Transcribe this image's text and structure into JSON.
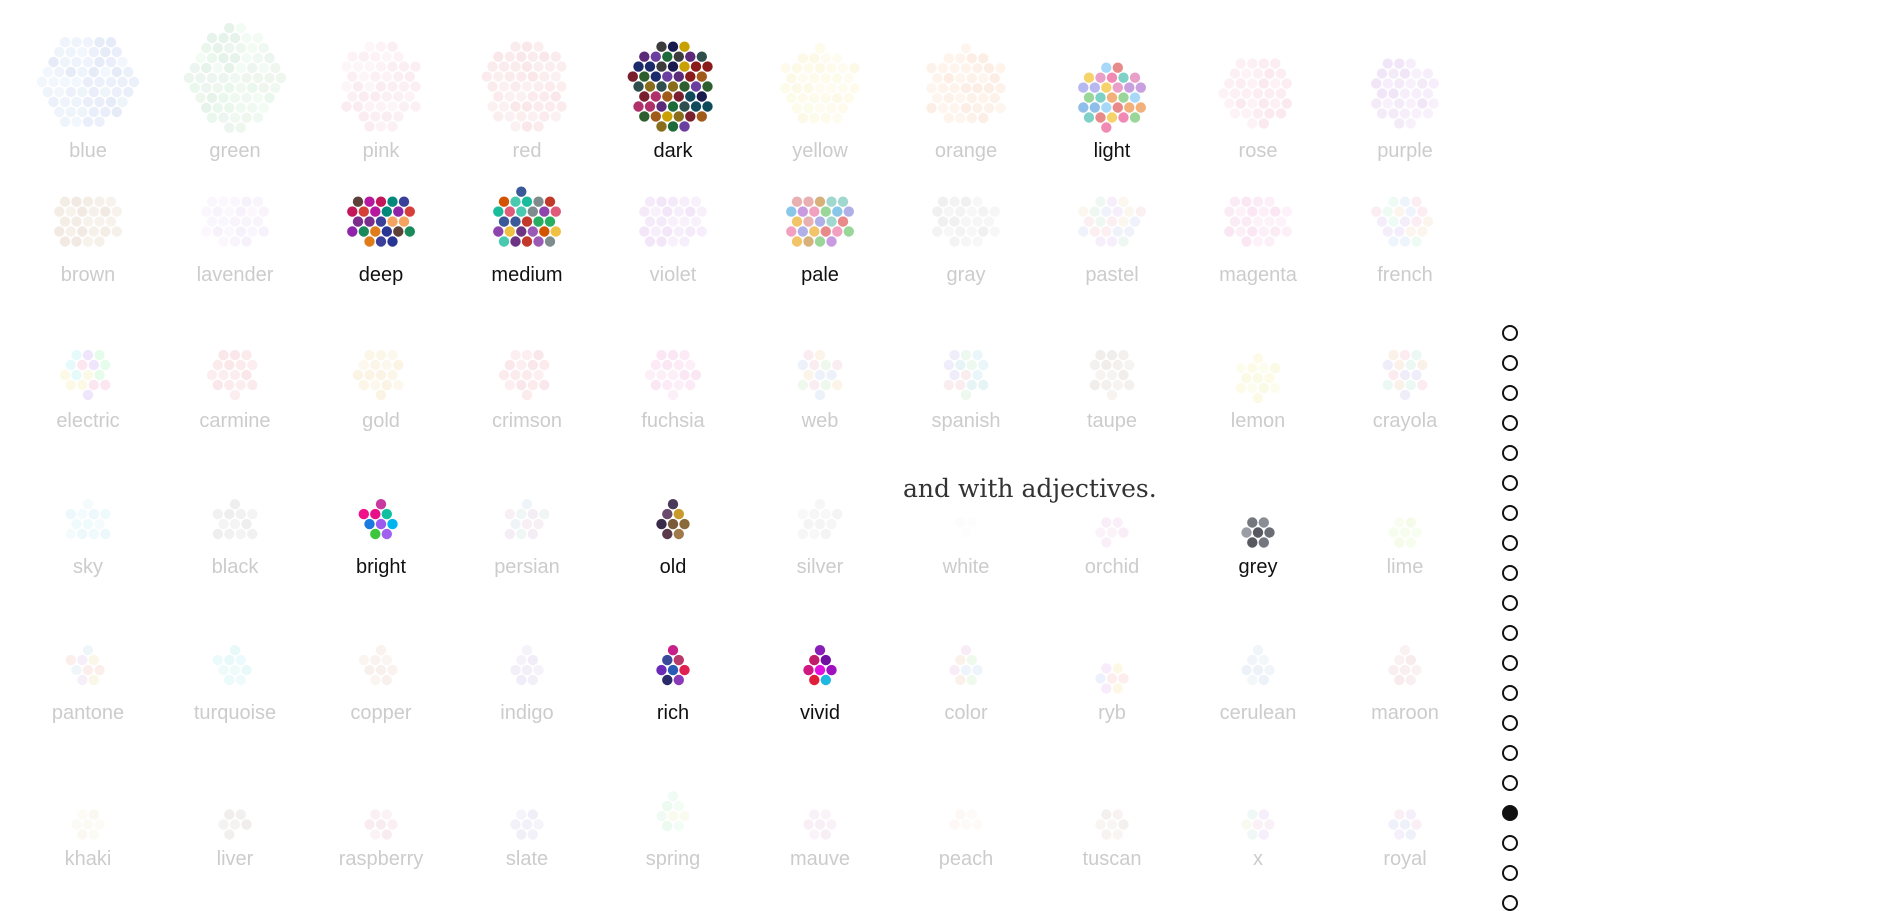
{
  "caption": "and with adjectives.",
  "pager": {
    "count": 20,
    "current": 16
  },
  "rows": [
    [
      {
        "label": "blue",
        "active": false,
        "n": 60,
        "palette": [
          "#b4c6ee",
          "#c7d6f5",
          "#a8b8e8",
          "#d3e0fa",
          "#bccbef",
          "#c0d9f0"
        ]
      },
      {
        "label": "green",
        "active": false,
        "n": 65,
        "palette": [
          "#b5e6c2",
          "#c9edcf",
          "#a9d6b5",
          "#d7f2dc",
          "#bcdcc8",
          "#c8e0c0"
        ]
      },
      {
        "label": "pink",
        "active": false,
        "n": 48,
        "palette": [
          "#f6c8d8",
          "#f9d5e2",
          "#f2bdd0",
          "#fbe0ea",
          "#f4cadb"
        ]
      },
      {
        "label": "red",
        "active": false,
        "n": 52,
        "palette": [
          "#f1b8bf",
          "#f4c4c9",
          "#eeaab3",
          "#f7d0d4",
          "#f0bcc2"
        ]
      },
      {
        "label": "dark",
        "active": true,
        "n": 52,
        "palette": [
          "#1b2a6b",
          "#7a1f2e",
          "#2c5e2e",
          "#5b2a78",
          "#8a6d1a",
          "#3c3c3c",
          "#0e4a5a",
          "#8b1a1a",
          "#1a1a4e",
          "#a05a1a",
          "#2f4f4f",
          "#6b3fa0",
          "#c8a000",
          "#1e6b3a",
          "#b0306a"
        ]
      },
      {
        "label": "yellow",
        "active": false,
        "n": 40,
        "palette": [
          "#fbf1b6",
          "#fdf6cc",
          "#f8ebaa",
          "#fdf3c0"
        ]
      },
      {
        "label": "orange",
        "active": false,
        "n": 42,
        "palette": [
          "#fbd1b2",
          "#fdddc5",
          "#f9c6a4",
          "#fcd8bc"
        ]
      },
      {
        "label": "light",
        "active": true,
        "n": 30,
        "palette": [
          "#8fbfe8",
          "#f08ab4",
          "#9ad69a",
          "#f5d36a",
          "#c8a0e0",
          "#e88a8a",
          "#7fd1c7",
          "#f2b07a",
          "#b8b8f0",
          "#a8d8f8",
          "#e8a0c8"
        ]
      },
      {
        "label": "rose",
        "active": false,
        "n": 34,
        "palette": [
          "#f3c0cf",
          "#f6ccd8",
          "#efb4c6",
          "#f8d4de"
        ]
      },
      {
        "label": "purple",
        "active": false,
        "n": 32,
        "palette": [
          "#dab8ec",
          "#e3c6f2",
          "#d0a9e6",
          "#e8cff4"
        ]
      }
    ],
    [
      {
        "label": "brown",
        "active": false,
        "n": 26,
        "palette": [
          "#dbc0a7",
          "#e2cbb5",
          "#d4b59a",
          "#e6d2be"
        ]
      },
      {
        "label": "lavender",
        "active": false,
        "n": 25,
        "palette": [
          "#ead8f6",
          "#f0e2f9",
          "#e4cff2",
          "#f2e6fa"
        ]
      },
      {
        "label": "deep",
        "active": true,
        "n": 25,
        "palette": [
          "#b5179e",
          "#d43f3a",
          "#7b2d8e",
          "#1b8a5a",
          "#e07b1a",
          "#3a3f9a",
          "#c2185b",
          "#00897b",
          "#8e24aa",
          "#f4a460",
          "#5d4037",
          "#283593"
        ]
      },
      {
        "label": "medium",
        "active": true,
        "n": 28,
        "palette": [
          "#9b59b6",
          "#48c9b0",
          "#e05a7a",
          "#3b5998",
          "#f0c040",
          "#6c3483",
          "#c0392b",
          "#1abc9c",
          "#7f8c8d",
          "#8e44ad",
          "#27ae60",
          "#d35400"
        ]
      },
      {
        "label": "violet",
        "active": false,
        "n": 26,
        "palette": [
          "#dcb6ee",
          "#e5c6f2",
          "#d3a8e8",
          "#e9cff5"
        ]
      },
      {
        "label": "pale",
        "active": true,
        "n": 26,
        "palette": [
          "#e88a8a",
          "#8ac6e8",
          "#9ad69a",
          "#f2c46a",
          "#c89ae0",
          "#f2a0c0",
          "#a0d8d0",
          "#d8b07a",
          "#b0b0e8",
          "#e8b0b0"
        ]
      },
      {
        "label": "gray",
        "active": false,
        "n": 24,
        "palette": [
          "#d6d6d6",
          "#e0e0e0",
          "#cccccc",
          "#e6e6e6"
        ]
      },
      {
        "label": "pastel",
        "active": false,
        "n": 22,
        "palette": [
          "#f3c7d4",
          "#c7e6d4",
          "#c7d4f3",
          "#f3e6c7",
          "#e0c7f3"
        ]
      },
      {
        "label": "magenta",
        "active": false,
        "n": 24,
        "palette": [
          "#f2b8dd",
          "#f6c8e5",
          "#eeaad6",
          "#f8d2ea"
        ]
      },
      {
        "label": "french",
        "active": false,
        "n": 20,
        "palette": [
          "#f6c1d2",
          "#c6d8f2",
          "#d8c6f2",
          "#c6f2dc",
          "#f2dcc6"
        ]
      }
    ],
    [
      {
        "label": "electric",
        "active": false,
        "n": 16,
        "palette": [
          "#c8a8f6",
          "#f6f0a8",
          "#a8f0f6",
          "#f6a8c8",
          "#a8f6b8"
        ]
      },
      {
        "label": "carmine",
        "active": false,
        "n": 16,
        "palette": [
          "#f2b8c0",
          "#f6c6cc",
          "#eeacb6"
        ]
      },
      {
        "label": "gold",
        "active": false,
        "n": 16,
        "palette": [
          "#f6e0b0",
          "#f9e9c4",
          "#f3d7a0"
        ]
      },
      {
        "label": "crimson",
        "active": false,
        "n": 16,
        "palette": [
          "#f3b8c2",
          "#f6c6ce",
          "#efacb8"
        ]
      },
      {
        "label": "fuchsia",
        "active": false,
        "n": 17,
        "palette": [
          "#f6b8e0",
          "#f9c8e8",
          "#f2aad8"
        ]
      },
      {
        "label": "web",
        "active": false,
        "n": 14,
        "palette": [
          "#f6d8b0",
          "#c8e8c0",
          "#f0c0d0",
          "#c0d0f0"
        ]
      },
      {
        "label": "spanish",
        "active": false,
        "n": 15,
        "palette": [
          "#b8e0f0",
          "#c0e8c8",
          "#f0c0c8",
          "#c8c0f0",
          "#a8d8e0"
        ]
      },
      {
        "label": "taupe",
        "active": false,
        "n": 15,
        "palette": [
          "#d8ccc4",
          "#e0d6ce",
          "#d0c2b8"
        ]
      },
      {
        "label": "lemon",
        "active": false,
        "n": 13,
        "palette": [
          "#f8f4b0",
          "#fbf8c8",
          "#f4f0a0"
        ]
      },
      {
        "label": "crayola",
        "active": false,
        "n": 15,
        "palette": [
          "#f6b8c8",
          "#b8e8d8",
          "#f0d0b0",
          "#c8c0f0"
        ]
      }
    ],
    [
      {
        "label": "sky",
        "active": false,
        "n": 12,
        "palette": [
          "#c8eef8",
          "#d6f3fb",
          "#bce8f5"
        ]
      },
      {
        "label": "black",
        "active": false,
        "n": 12,
        "palette": [
          "#cfcfcf",
          "#d8d8d8",
          "#c6c6c6"
        ]
      },
      {
        "label": "bright",
        "active": true,
        "n": 9,
        "palette": [
          "#e8108a",
          "#3dc63d",
          "#9b59f0",
          "#00b4f0",
          "#f0108a",
          "#1a7ae0",
          "#c83aa0",
          "#10c0a0",
          "#a060f0"
        ]
      },
      {
        "label": "persian",
        "active": false,
        "n": 11,
        "palette": [
          "#e8c8d8",
          "#c8d8e8",
          "#d8c0e0",
          "#c8e0d8"
        ]
      },
      {
        "label": "old",
        "active": true,
        "n": 8,
        "palette": [
          "#5a3a4a",
          "#8a6a3a",
          "#3a2a4a",
          "#c89a2a",
          "#6a4a6a",
          "#7a5a3a",
          "#4a3a5a",
          "#a07a4a"
        ]
      },
      {
        "label": "silver",
        "active": false,
        "n": 11,
        "palette": [
          "#e0e0e0",
          "#e8e8e8",
          "#d8d8d8"
        ]
      },
      {
        "label": "white",
        "active": false,
        "n": 3,
        "palette": [
          "#f6f6f6",
          "#f8f8f8"
        ]
      },
      {
        "label": "orchid",
        "active": false,
        "n": 6,
        "palette": [
          "#f0c8ec",
          "#f4d4f0",
          "#ecc0e6"
        ]
      },
      {
        "label": "grey",
        "active": true,
        "n": 7,
        "palette": [
          "#6a6e74",
          "#8a8e94",
          "#565a60",
          "#9a9ea4",
          "#74787e"
        ]
      },
      {
        "label": "lime",
        "active": false,
        "n": 7,
        "palette": [
          "#e0f8c0",
          "#e8fad0",
          "#d8f4b4"
        ]
      }
    ],
    [
      {
        "label": "pantone",
        "active": false,
        "n": 9,
        "palette": [
          "#f6c8b8",
          "#c8e0f0",
          "#f0e0b0",
          "#e0c8f0"
        ]
      },
      {
        "label": "turquoise",
        "active": false,
        "n": 9,
        "palette": [
          "#b8f0ee",
          "#c8f4f2",
          "#acece8"
        ]
      },
      {
        "label": "copper",
        "active": false,
        "n": 9,
        "palette": [
          "#ecd4c8",
          "#f0dcd0",
          "#e8ccbe"
        ]
      },
      {
        "label": "indigo",
        "active": false,
        "n": 8,
        "palette": [
          "#d4c8ec",
          "#dcd2f0",
          "#ccc0e8"
        ]
      },
      {
        "label": "rich",
        "active": true,
        "n": 8,
        "palette": [
          "#2a5ab8",
          "#c8208a",
          "#8a3ab8",
          "#2a2a6a",
          "#e02050",
          "#6a2ab8",
          "#b83a6a",
          "#3a4a9a"
        ]
      },
      {
        "label": "vivid",
        "active": true,
        "n": 8,
        "palette": [
          "#c01e6a",
          "#e010e0",
          "#8a1eb8",
          "#1eb8e0",
          "#e01e3a",
          "#a010c0",
          "#d01880",
          "#7010a0"
        ]
      },
      {
        "label": "color",
        "active": false,
        "n": 8,
        "palette": [
          "#c8eec0",
          "#f0d0b8",
          "#c0d8f0",
          "#e8c0e0"
        ]
      },
      {
        "label": "ryb",
        "active": false,
        "n": 7,
        "palette": [
          "#c0d0f8",
          "#f8e8a8",
          "#e8b8f0",
          "#f8c0c0"
        ]
      },
      {
        "label": "cerulean",
        "active": false,
        "n": 8,
        "palette": [
          "#c8dcec",
          "#d4e4f0",
          "#bcd4e8"
        ]
      },
      {
        "label": "maroon",
        "active": false,
        "n": 8,
        "palette": [
          "#ecc4cc",
          "#f0d0d6",
          "#e6bac4"
        ]
      }
    ],
    [
      {
        "label": "khaki",
        "active": false,
        "n": 7,
        "palette": [
          "#f4eed8",
          "#f8f2e0",
          "#f0e8ce"
        ]
      },
      {
        "label": "liver",
        "active": false,
        "n": 6,
        "palette": [
          "#d4ccc8",
          "#dcd6d2",
          "#ccc2bc"
        ]
      },
      {
        "label": "raspberry",
        "active": false,
        "n": 7,
        "palette": [
          "#f0c8d6",
          "#f4d2de",
          "#ecbecc"
        ]
      },
      {
        "label": "slate",
        "active": false,
        "n": 7,
        "palette": [
          "#d4d0ec",
          "#dcd8f0",
          "#ccc8e6"
        ]
      },
      {
        "label": "spring",
        "active": false,
        "n": 8,
        "palette": [
          "#c8f4d8",
          "#d4f8e0",
          "#bcf0cc",
          "#f0f4c8"
        ]
      },
      {
        "label": "mauve",
        "active": false,
        "n": 7,
        "palette": [
          "#ecd0e8",
          "#f0d8ec",
          "#e6c6e2"
        ]
      },
      {
        "label": "peach",
        "active": false,
        "n": 5,
        "palette": [
          "#fbe8dc",
          "#fcefe6"
        ]
      },
      {
        "label": "tuscan",
        "active": false,
        "n": 7,
        "palette": [
          "#e8d4cc",
          "#ecdcd4",
          "#d8ccc8"
        ]
      },
      {
        "label": "x",
        "active": false,
        "n": 7,
        "palette": [
          "#e0f0c8",
          "#d8c8f0",
          "#c8e8e0",
          "#f0d0e0"
        ]
      },
      {
        "label": "royal",
        "active": false,
        "n": 7,
        "palette": [
          "#c8d0f0",
          "#f0c8d8",
          "#d8c8f0"
        ]
      }
    ]
  ]
}
